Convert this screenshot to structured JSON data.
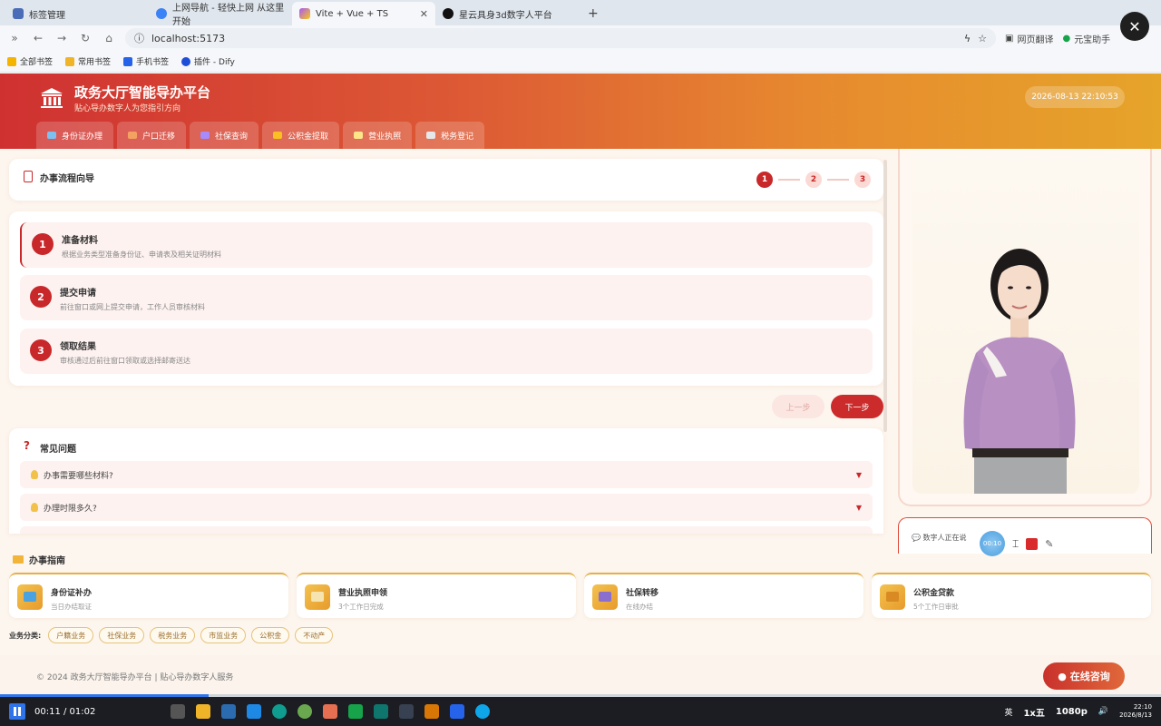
{
  "browser": {
    "tabs": [
      {
        "label": "标签管理",
        "active": false
      },
      {
        "label": "上网导航 - 轻快上网 从这里开始",
        "active": false
      },
      {
        "label": "Vite + Vue + TS",
        "active": true
      },
      {
        "label": "星云具身3d数字人平台",
        "active": false
      }
    ],
    "url": "localhost:5173",
    "right_tools": {
      "translate": "网页翻译",
      "assistant": "元宝助手"
    },
    "bookmarks": [
      "全部书签",
      "常用书签",
      "手机书签",
      "插件 - Dify"
    ]
  },
  "header": {
    "title": "政务大厅智能导办平台",
    "subtitle": "贴心导办数字人为您指引方向",
    "datetime": "2026-08-13 22:10:53",
    "service_tabs": [
      "身份证办理",
      "户口迁移",
      "社保查询",
      "公积金提取",
      "营业执照",
      "税务登记"
    ]
  },
  "flow": {
    "title": "办事流程向导",
    "stepper": [
      "1",
      "2",
      "3"
    ],
    "steps": [
      {
        "num": "1",
        "title": "准备材料",
        "desc": "根据业务类型准备身份证、申请表及相关证明材料"
      },
      {
        "num": "2",
        "title": "提交申请",
        "desc": "前往窗口或网上提交申请，工作人员审核材料"
      },
      {
        "num": "3",
        "title": "领取结果",
        "desc": "审核通过后前往窗口领取或选择邮寄送达"
      }
    ],
    "prev_label": "上一步",
    "next_label": "下一步"
  },
  "faq": {
    "title": "常见问题",
    "items": [
      "办事需要哪些材料?",
      "办理时限多久?"
    ]
  },
  "avatar": {
    "status": "数字人正在说",
    "timer": "00:10",
    "bubble": "--:--"
  },
  "guide": {
    "title": "办事指南",
    "cards": [
      {
        "name": "身份证补办",
        "desc": "当日办结取证",
        "color": "#4aa3e0"
      },
      {
        "name": "营业执照申领",
        "desc": "3个工作日完成",
        "color": "#f5e3b0"
      },
      {
        "name": "社保转移",
        "desc": "在线办结",
        "color": "#8a6fd1"
      },
      {
        "name": "公积金贷款",
        "desc": "5个工作日审批",
        "color": "#d98a22"
      }
    ],
    "category_label": "业务分类:",
    "categories": [
      "户籍业务",
      "社保业务",
      "税务业务",
      "市监业务",
      "公积金",
      "不动产"
    ]
  },
  "footer": {
    "copyright": "© 2024 政务大厅智能导办平台 | 贴心导办数字人服务",
    "consult": "在线咨询"
  },
  "player": {
    "time": "00:11 / 01:02",
    "progress": 0.18,
    "tray": {
      "ime": "英",
      "speed": "1x五",
      "quality": "1080p",
      "clock_time": "22:10",
      "clock_date": "2026/8/13"
    }
  }
}
